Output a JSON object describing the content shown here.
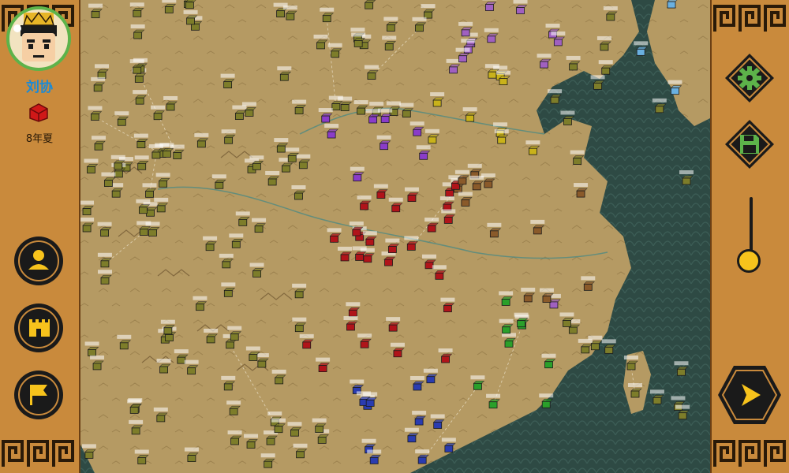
{
  "ruler": {
    "name": "刘协",
    "date": "8年夏",
    "flag_color": "#d01818"
  },
  "map": {
    "sea_color": "#2e4a44",
    "land_color": "#b59a63",
    "cities": [
      {
        "label": "郡县",
        "faction": "yellow"
      },
      {
        "label": "郡县",
        "faction": "olive"
      }
    ]
  },
  "factions": {
    "red": "#b0141a",
    "yellow": "#c9b21a",
    "olive": "#7d7d2a",
    "green": "#2aa02a",
    "purple": "#8a3cc9",
    "blue": "#2a3cb0",
    "cyan": "#1aa8b8",
    "brown": "#8a5a2a",
    "violet": "#a060c0",
    "lightblue": "#6ab0e0"
  },
  "buttons": {
    "character": "person-icon",
    "castle": "castle-icon",
    "flag": "flag-icon",
    "settings": "gear-icon",
    "save": "floppy-disk-icon",
    "end_turn": "play-arrow-icon"
  },
  "speed_slider": {
    "value": 0.2
  }
}
